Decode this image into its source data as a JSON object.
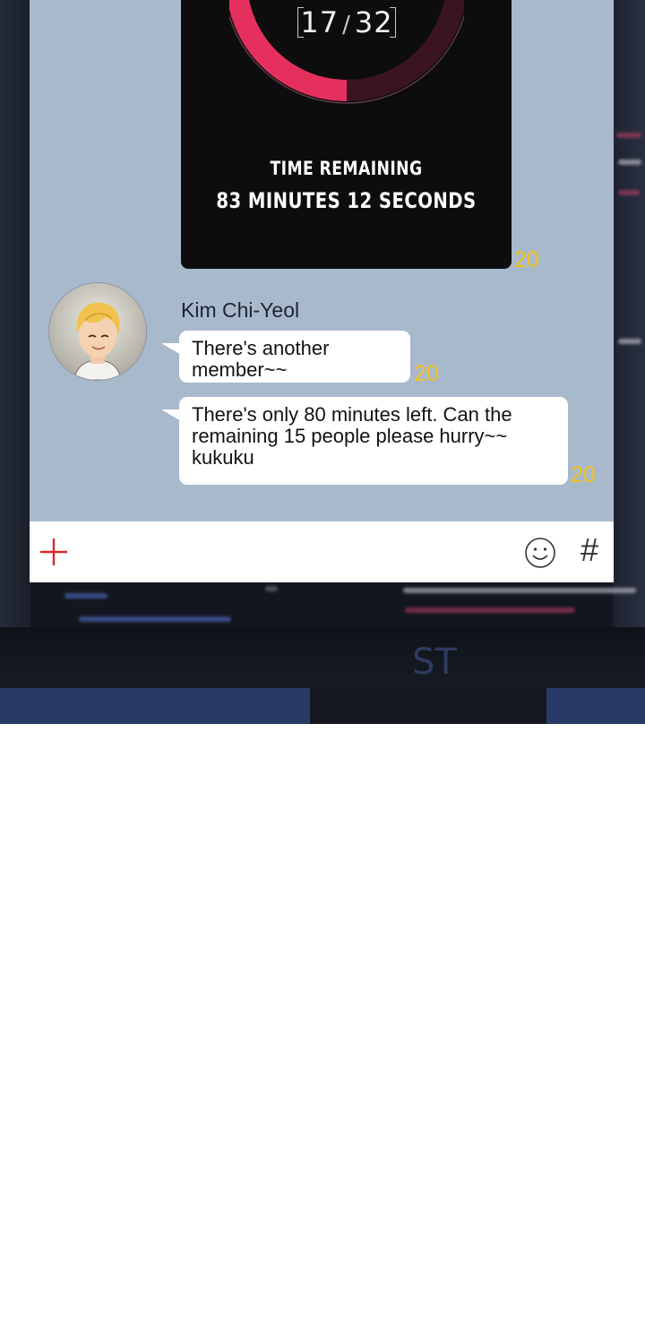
{
  "timer": {
    "count": "17",
    "separator": "/",
    "total": "32",
    "progress": 0.53,
    "label": "TIME REMAINING",
    "remaining": "83 MINUTES 12 SECONDS",
    "read_count": "20",
    "ring_color": "#e5305e"
  },
  "messages": [
    {
      "sender": "Kim Chi-Yeol",
      "lines": [
        "There's another",
        "member~~"
      ],
      "read_count": "20"
    },
    {
      "lines": [
        "There's only 80 minutes left. Can the",
        "remaining 15 people please hurry~~",
        "kukuku"
      ],
      "read_count": "20"
    }
  ],
  "input_bar": {
    "add_icon": "plus-icon",
    "emoji_icon": "smiley-icon",
    "hashtag_label": "#",
    "accent": "#d9282f"
  },
  "monitor": {
    "brand": "ST"
  },
  "colors": {
    "chat_background": "#a9b9cc",
    "read_count": "#f2c21b",
    "bubble": "#ffffff"
  }
}
